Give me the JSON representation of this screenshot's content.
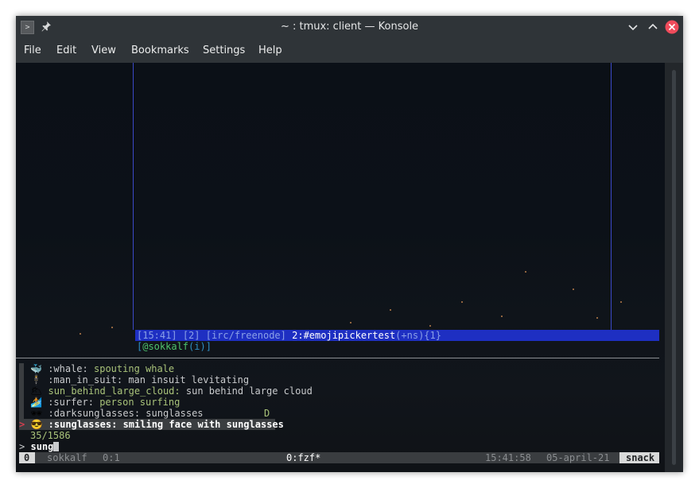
{
  "window": {
    "title": "~ : tmux: client — Konsole"
  },
  "menu": [
    "File",
    "Edit",
    "View",
    "Bookmarks",
    "Settings",
    "Help"
  ],
  "irc": {
    "time": "[15:41]",
    "num": "[2]",
    "server": "[irc/freenode]",
    "channel": "2:#emojipickertest",
    "mode": "(+ns)",
    "count": "{1}",
    "nick_open": "[",
    "nick": "@sokkalf",
    "nick_mode": "(i)",
    "nick_close": "]"
  },
  "fzf": {
    "items": [
      {
        "emoji": "🐳",
        "name": ":whale:",
        "desc": " spouting whale"
      },
      {
        "emoji": "🕴",
        "name": ":man_in_suit:",
        "desc": " man insuit levitating"
      },
      {
        "emoji": "🌥",
        "name": "sun_behind_large_cloud:",
        "desc": " sun behind large cloud"
      },
      {
        "emoji": "🏄",
        "name": ":surfer:",
        "desc": " person surfing"
      },
      {
        "emoji": "🕶",
        "name": ":darksunglasses:",
        "desc": " sunglasses",
        "extra": "D"
      }
    ],
    "selected": {
      "pointer": ">",
      "emoji": "😎",
      "name": ":sunglasses:",
      "desc": " smiling face with sunglasses"
    },
    "count": "35/1586",
    "prompt": ">",
    "query": "sung"
  },
  "statusbar": {
    "session": "0",
    "host": "sokkalf",
    "pane": "0:1",
    "window": "0:fzf*",
    "time": "15:41:58",
    "date": "05-april-21",
    "name": "snack"
  }
}
